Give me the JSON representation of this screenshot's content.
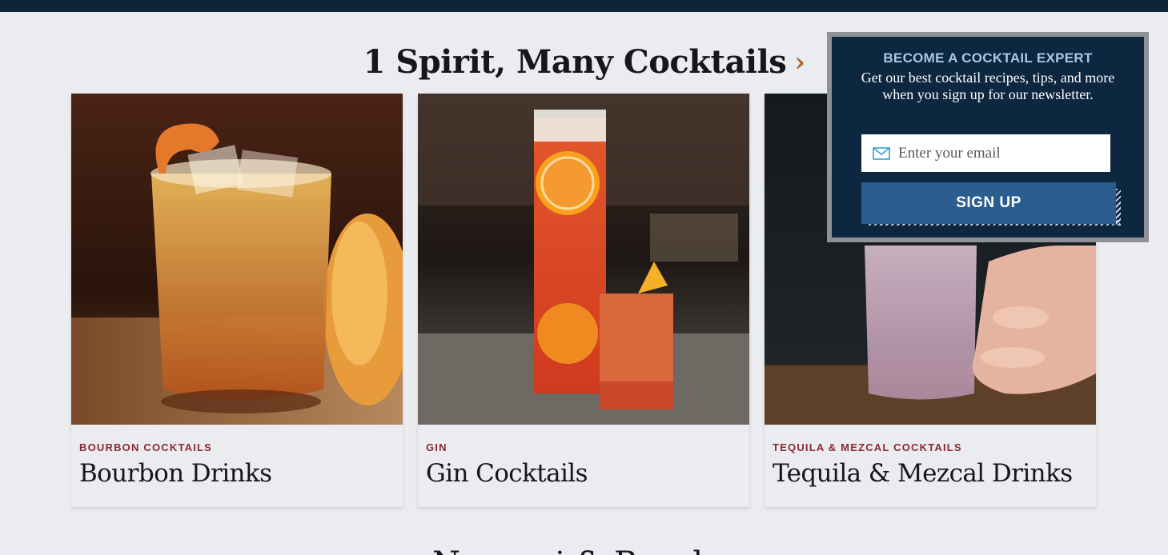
{
  "section": {
    "heading": "1 Spirit, Many Cocktails",
    "next_heading": "Negroni & Bourbon"
  },
  "cards": [
    {
      "category": "BOURBON COCKTAILS",
      "title": "Bourbon Drinks"
    },
    {
      "category": "GIN",
      "title": "Gin Cocktails"
    },
    {
      "category": "TEQUILA & MEZCAL COCKTAILS",
      "title": "Tequila & Mezcal Drinks"
    }
  ],
  "newsletter": {
    "title": "BECOME A COCKTAIL EXPERT",
    "text": "Get our best cocktail recipes, tips, and more when you sign up for our newsletter.",
    "email_placeholder": "Enter your email",
    "button_label": "SIGN UP"
  },
  "colors": {
    "top_bar": "#0e2538",
    "accent_chevron": "#b06c2c",
    "category": "#8a2a2e",
    "popup_bg": "#0d2740",
    "button": "#2b5d8f"
  },
  "icons": {
    "heading_chevron": "chevron-right-icon",
    "email": "mail-icon"
  }
}
